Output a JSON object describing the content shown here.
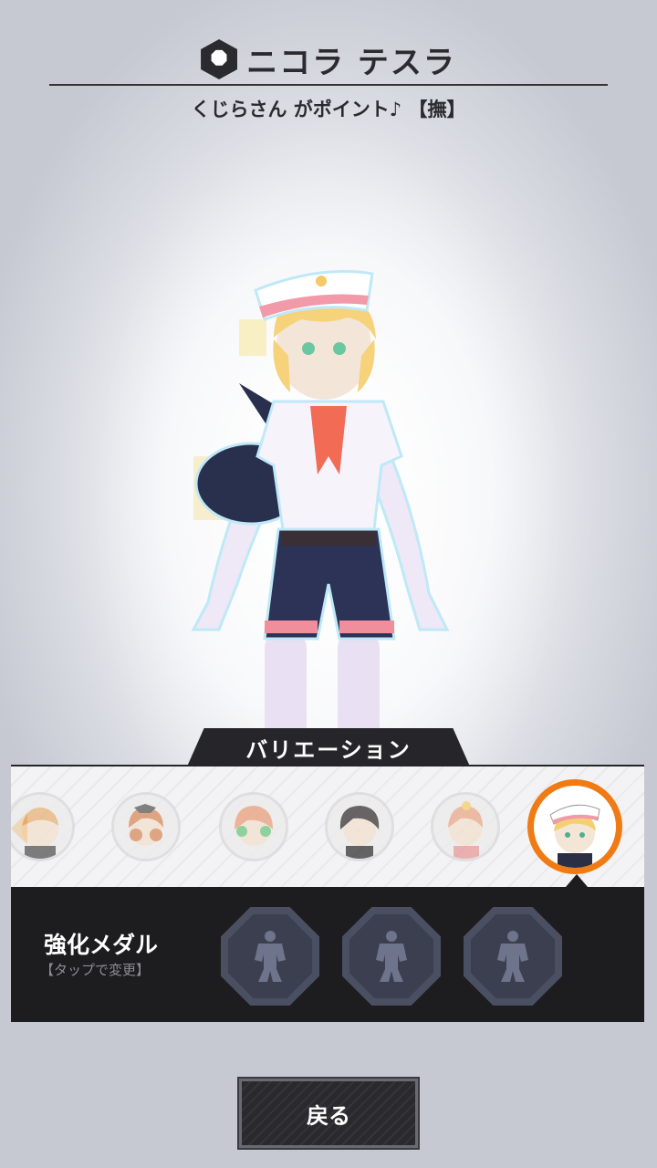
{
  "header": {
    "badge_icon": "boot-icon",
    "character_name": "ニコラ テスラ",
    "costume_name": "くじらさん がポイント♪ 【撫】"
  },
  "variation": {
    "tab_label": "バリエーション",
    "scroll_icon": "chevron-left-icon",
    "accent_color": "#f07a14",
    "thumbnails": [
      {
        "name": "variation-1"
      },
      {
        "name": "variation-2"
      },
      {
        "name": "variation-3"
      },
      {
        "name": "variation-4"
      },
      {
        "name": "variation-5"
      },
      {
        "name": "variation-6",
        "selected": true
      }
    ]
  },
  "medals": {
    "title": "強化メダル",
    "hint": "【タップで変更】",
    "slots": [
      {
        "icon": "hero-silhouette-icon"
      },
      {
        "icon": "hero-silhouette-icon"
      },
      {
        "icon": "hero-silhouette-icon"
      }
    ]
  },
  "footer": {
    "back_label": "戻る"
  }
}
